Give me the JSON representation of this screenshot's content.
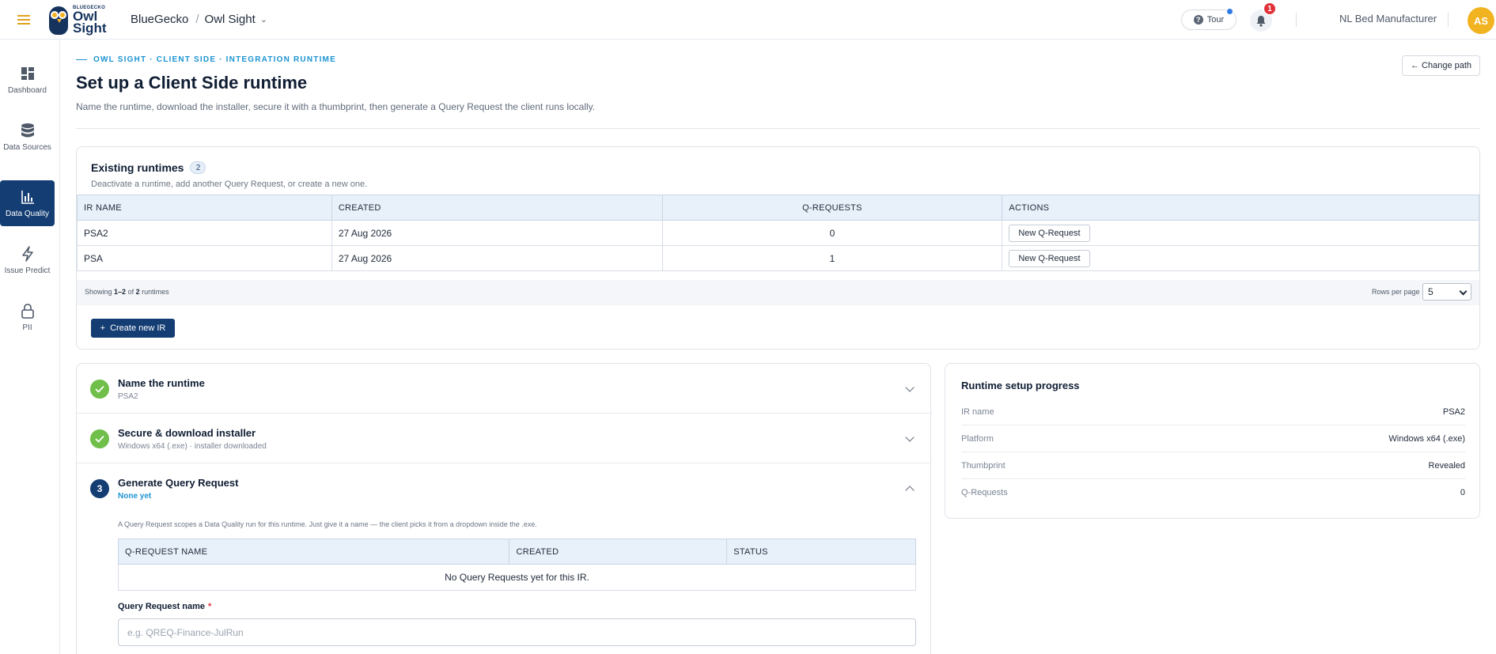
{
  "header": {
    "logo_small": "BLUEGECKO",
    "logo_line1": "Owl",
    "logo_line2": "Sight",
    "org": "BlueGecko",
    "product": "Owl Sight",
    "tour_label": "Tour",
    "notifications_count": "1",
    "tenant": "NL Bed Manufacturer",
    "avatar_initials": "AS"
  },
  "sidebar": {
    "items": [
      {
        "label": "Dashboard",
        "icon": "dashboard-icon"
      },
      {
        "label": "Data Sources",
        "icon": "database-icon"
      },
      {
        "label": "Data Quality",
        "icon": "bar-chart-icon",
        "active": true
      },
      {
        "label": "Issue Predict",
        "icon": "lightning-icon"
      },
      {
        "label": "PII",
        "icon": "lock-icon"
      }
    ]
  },
  "page": {
    "eyebrow": "OWL SIGHT · CLIENT SIDE · INTEGRATION RUNTIME",
    "title": "Set up a Client Side runtime",
    "subtitle": "Name the runtime, download the installer, secure it with a thumbprint, then generate a Query Request the client runs locally.",
    "change_path": "← Change path"
  },
  "runtimes": {
    "title": "Existing runtimes",
    "count": "2",
    "subtitle": "Deactivate a runtime, add another Query Request, or create a new one.",
    "columns": [
      "IR NAME",
      "CREATED",
      "Q-REQUESTS",
      "ACTIONS"
    ],
    "rows": [
      {
        "name": "PSA2",
        "created": "27 Aug 2026",
        "qrequests": "0",
        "action": "New Q-Request"
      },
      {
        "name": "PSA",
        "created": "27 Aug 2026",
        "qrequests": "1",
        "action": "New Q-Request"
      }
    ],
    "showing_prefix": "Showing ",
    "showing_range": "1–2",
    "showing_mid": " of ",
    "showing_total": "2",
    "showing_suffix": " runtimes",
    "rows_per_page_label": "Rows per page",
    "rows_per_page": "5",
    "create_label": "Create new IR"
  },
  "steps": [
    {
      "number": "",
      "title": "Name the runtime",
      "meta": "PSA2",
      "state": "done"
    },
    {
      "number": "",
      "title": "Secure & download installer",
      "meta": "Windows x64 (.exe) · installer downloaded",
      "state": "done"
    },
    {
      "number": "3",
      "title": "Generate Query Request",
      "meta": "None yet",
      "state": "active"
    }
  ],
  "query_request": {
    "description": "A Query Request scopes a Data Quality run for this runtime. Just give it a name — the client picks it from a dropdown inside the .exe.",
    "columns": [
      "Q-REQUEST NAME",
      "CREATED",
      "STATUS"
    ],
    "empty": "No Query Requests yet for this IR.",
    "name_label": "Query Request name",
    "required_mark": "*",
    "placeholder": "e.g. QREQ-Finance-JulRun"
  },
  "progress": {
    "title": "Runtime setup progress",
    "rows": [
      {
        "key": "IR name",
        "value": "PSA2"
      },
      {
        "key": "Platform",
        "value": "Windows x64 (.exe)"
      },
      {
        "key": "Thumbprint",
        "value": "Revealed"
      },
      {
        "key": "Q-Requests",
        "value": "0"
      }
    ]
  },
  "colors": {
    "accent": "#143d73",
    "brand_yellow": "#f2b321",
    "success": "#6fbf4a",
    "eyebrow": "#1d94d2",
    "alert": "#e0323a"
  }
}
